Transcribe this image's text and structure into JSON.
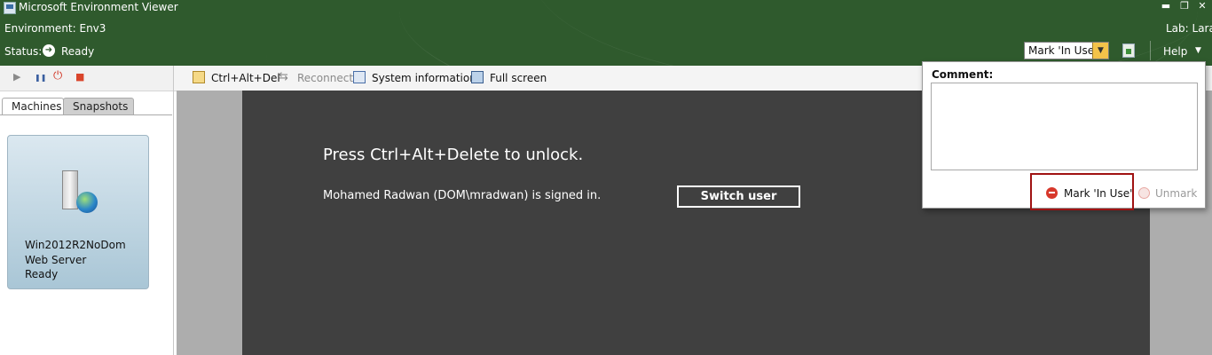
{
  "window": {
    "title": "Microsoft Environment Viewer",
    "controls": [
      "minimize-icon",
      "restore-icon",
      "close-icon"
    ]
  },
  "header": {
    "environment_label": "Environment: Env3",
    "status_label": "Status:",
    "status_value": "Ready",
    "lab_label": "Lab: Lara",
    "mark_select_value": "Mark 'In Use'",
    "help_label": "Help",
    "help_arrow": "▼",
    "select_arrow": "▼",
    "ready_glyph": "➜",
    "colors": {
      "header_bg": "#2f5a2d",
      "select_arrow_bg": "#f3c34a"
    }
  },
  "vm_toolbar": {
    "icons": [
      "play-icon",
      "pause-icon",
      "power-icon",
      "stop-icon"
    ],
    "play_glyph": "▶",
    "pause_glyph": "❚❚",
    "power_glyph": "⏻",
    "stop_glyph": "■"
  },
  "left_tabs": [
    {
      "label": "Machines",
      "active": true
    },
    {
      "label": "Snapshots",
      "active": false
    }
  ],
  "machine": {
    "name": "Win2012R2NoDom",
    "role": "Web Server",
    "status": "Ready"
  },
  "main_toolbar": {
    "ctrl_alt_del": "Ctrl+Alt+Del",
    "reconnect": "Reconnect",
    "system_information": "System information",
    "full_screen": "Full screen"
  },
  "remote": {
    "unlock_message": "Press Ctrl+Alt+Delete to unlock.",
    "signed_in_message": "Mohamed Radwan (DOM\\mradwan) is signed in.",
    "switch_user_label": "Switch user"
  },
  "popup": {
    "comment_label": "Comment:",
    "comment_value": "",
    "mark_in_use_label": "Mark 'In Use'",
    "unmark_label": "Unmark"
  }
}
